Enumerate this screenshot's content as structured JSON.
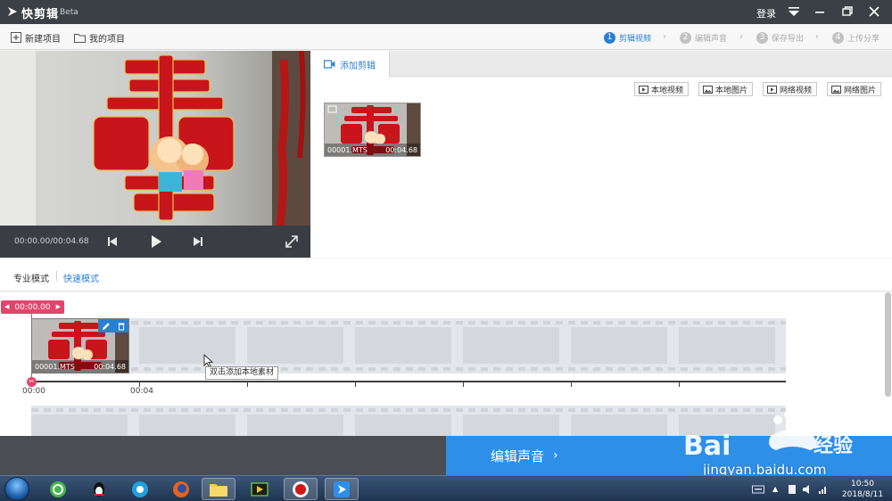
{
  "app": {
    "title": "快剪辑",
    "beta": "Beta",
    "login": "登录"
  },
  "toolbar": {
    "new_project": "新建项目",
    "my_projects": "我的项目",
    "steps": [
      {
        "num": "1",
        "label": "剪辑视频"
      },
      {
        "num": "2",
        "label": "编辑声音"
      },
      {
        "num": "3",
        "label": "保存导出"
      },
      {
        "num": "4",
        "label": "上传分享"
      }
    ]
  },
  "player": {
    "time": "00:00.00/00:04.68"
  },
  "library": {
    "tab": "添加剪辑",
    "sources": [
      "本地视频",
      "本地图片",
      "网络视频",
      "网络图片"
    ],
    "clip": {
      "name": "00001.MTS",
      "duration": "00:04.68"
    }
  },
  "modes": {
    "pro": "专业模式",
    "quick": "快速模式"
  },
  "timeline": {
    "playhead": "00:00.00",
    "clip": {
      "name": "00001.MTS",
      "duration": "00:04.68"
    },
    "ruler": [
      "00:00",
      "00:04"
    ],
    "tooltip": "双击添加本地素材"
  },
  "bottom": {
    "next": "编辑声音"
  },
  "taskbar": {
    "time": "10:50",
    "date": "2018/8/11"
  },
  "watermark": {
    "site": "jingyan.baidu.com"
  },
  "colors": {
    "accent": "#2a7fd1",
    "next_button": "#2e8fe8",
    "playhead": "#e2456c",
    "titlebar": "#3b4046"
  }
}
